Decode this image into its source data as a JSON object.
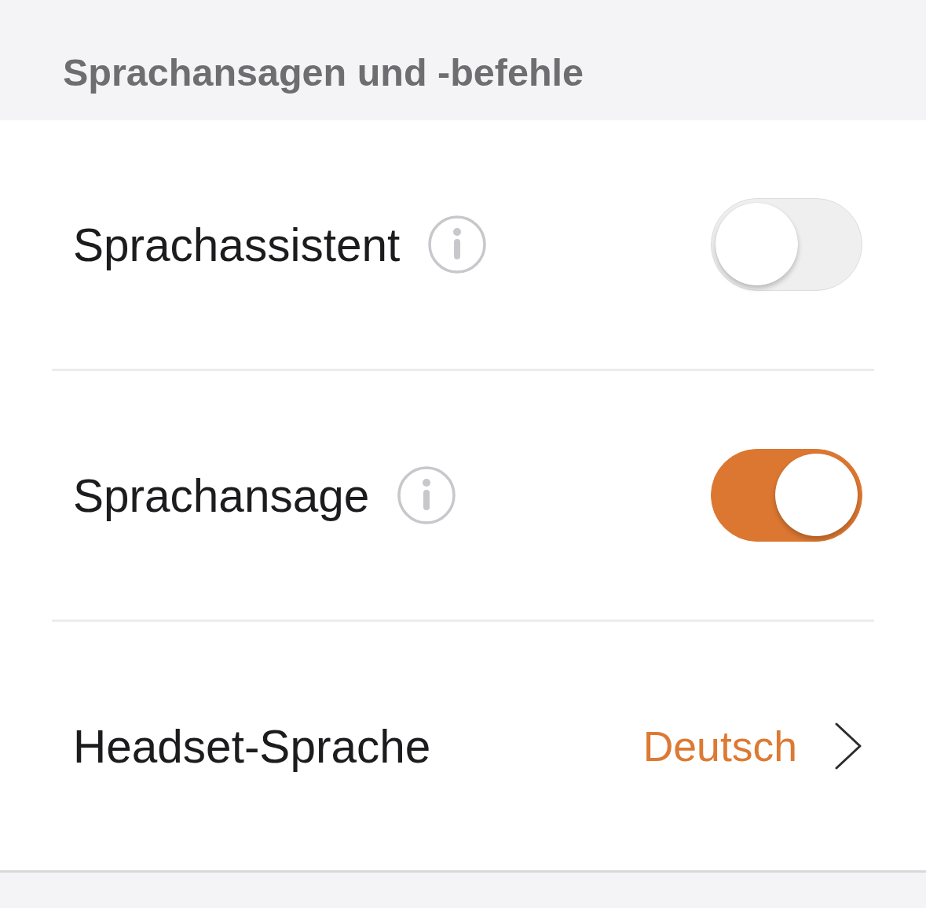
{
  "section": {
    "title": "Sprachansagen und -befehle"
  },
  "rows": [
    {
      "kind": "toggle",
      "label": "Sprachassistent",
      "info": true,
      "on": false
    },
    {
      "kind": "toggle",
      "label": "Sprachansage",
      "info": true,
      "on": true
    },
    {
      "kind": "link",
      "label": "Headset-Sprache",
      "value": "Deutsch"
    }
  ]
}
